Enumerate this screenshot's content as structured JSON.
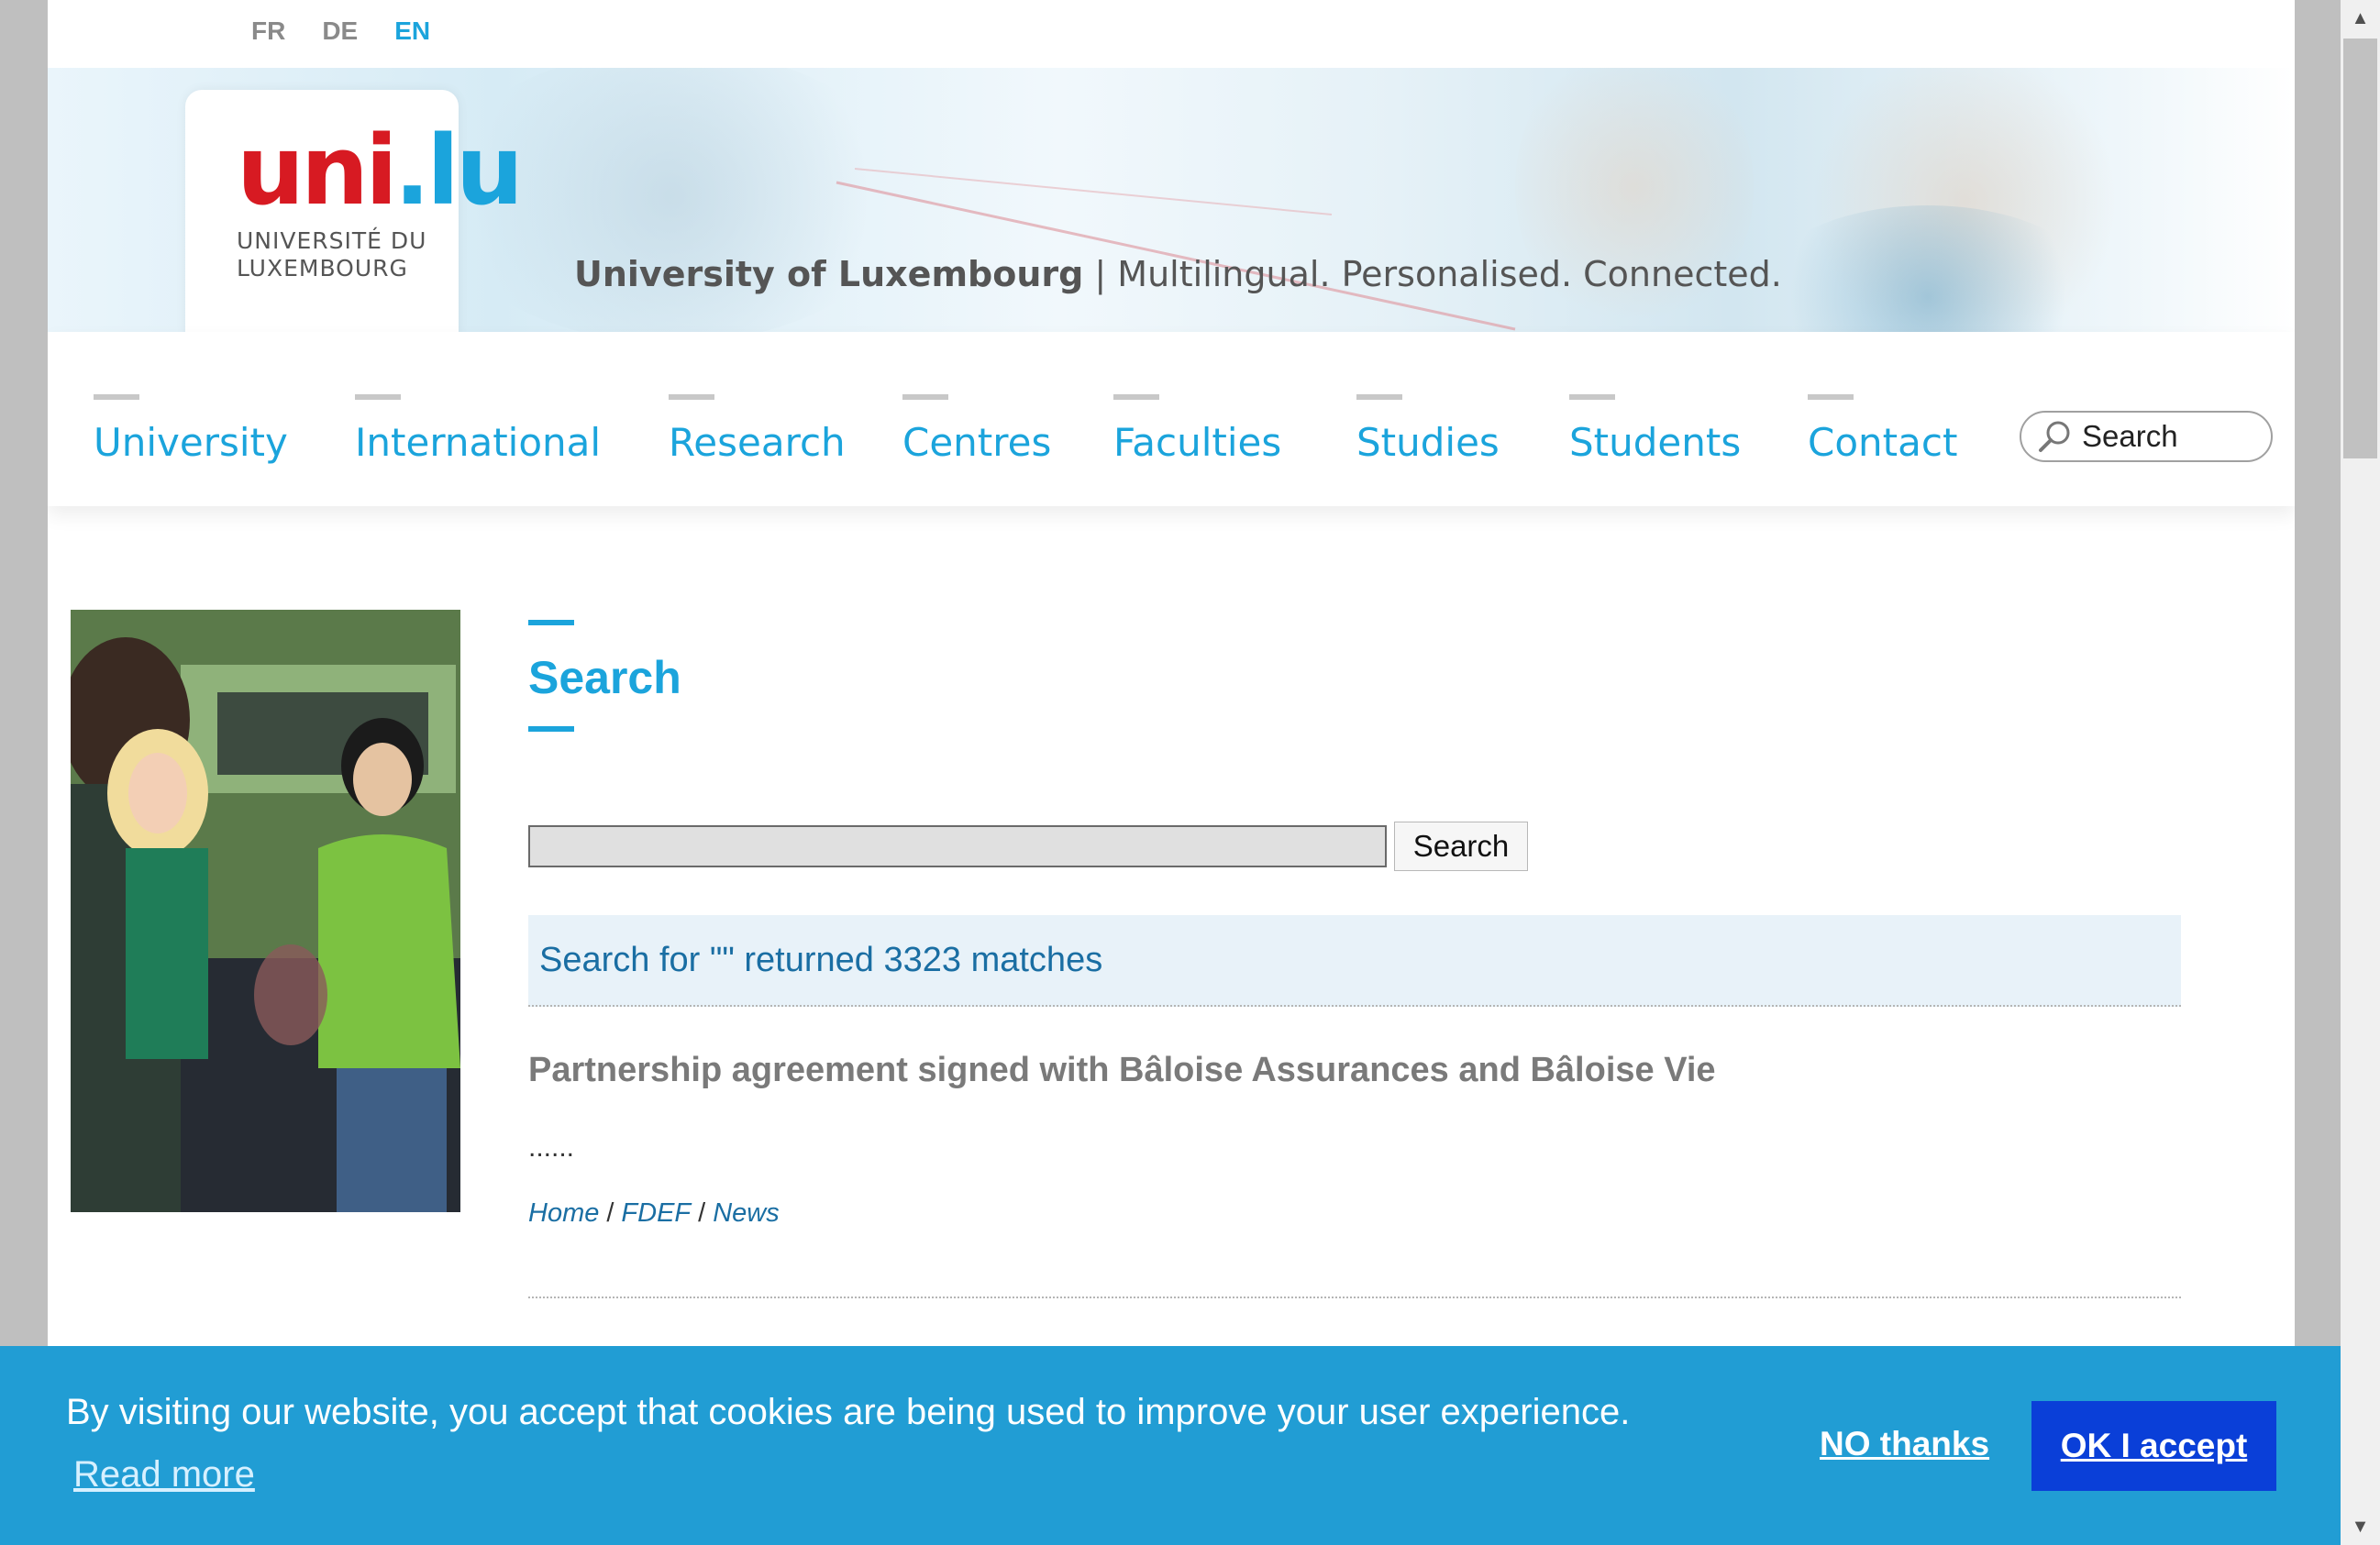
{
  "languages": [
    {
      "label": "FR",
      "active": false
    },
    {
      "label": "DE",
      "active": false
    },
    {
      "label": "EN",
      "active": true
    }
  ],
  "logo": {
    "mark_red": "uni",
    "mark_dot": ".",
    "mark_blue": "lu",
    "line1": "UNIVERSITÉ DU",
    "line2": "LUXEMBOURG"
  },
  "tagline": {
    "bold": "University of Luxembourg",
    "rest": " | Multilingual. Personalised. Connected."
  },
  "nav": {
    "items": [
      "University",
      "International",
      "Research",
      "Centres",
      "Faculties",
      "Studies",
      "Students",
      "Contact"
    ],
    "search_placeholder": "Search"
  },
  "search": {
    "title": "Search",
    "input_value": "",
    "button_label": "Search",
    "results_summary": "Search for \"\" returned 3323 matches"
  },
  "results": [
    {
      "title": "Partnership agreement signed with Bâloise Assurances and Bâloise Vie",
      "snippet": "......",
      "breadcrumb": [
        "Home",
        "FDEF",
        "News"
      ]
    }
  ],
  "cookie": {
    "message": "By visiting our website, you accept that cookies are being used to improve your user experience.",
    "read_more": "Read more",
    "decline": "NO thanks",
    "accept": "OK I accept"
  },
  "colors": {
    "accent": "#1ba4dc",
    "brand_red": "#d71a22",
    "cookie_bg": "#219dd4",
    "accept_button": "#0a3fd8"
  }
}
